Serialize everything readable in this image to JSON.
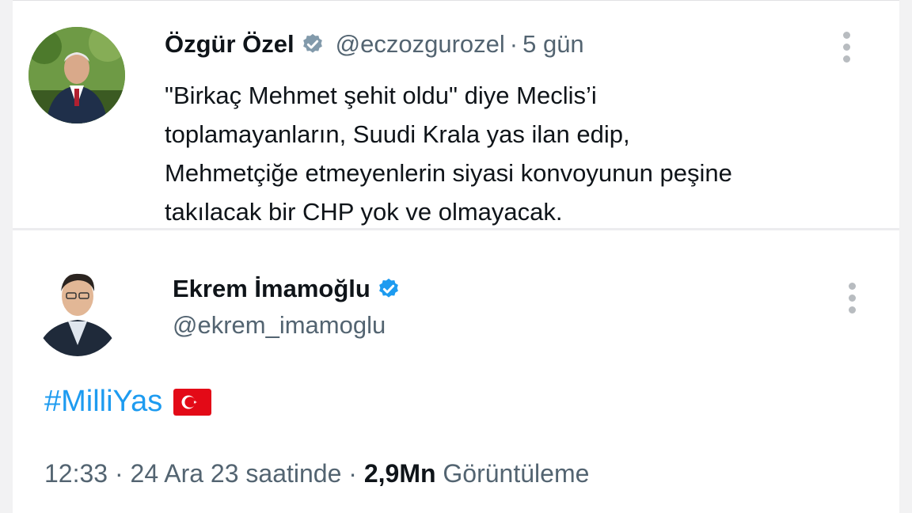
{
  "tweet1": {
    "author_name": "Özgür Özel",
    "handle": "@eczozgurozel",
    "separator": "·",
    "time": "5 gün",
    "text_lines": [
      "\"Birkaç Mehmet şehit oldu\" diye Meclis’i",
      "toplamayanların, Suudi Krala yas ilan edip,",
      "Mehmetçiğe etmeyenlerin siyasi konvoyunun peşine",
      "takılacak bir CHP yok ve olmayacak."
    ],
    "verified": true,
    "more_icon": "more-vertical-icon"
  },
  "tweet2": {
    "author_name": "Ekrem İmamoğlu",
    "handle": "@ekrem_imamoglu",
    "hashtag": "#MilliYas",
    "flag": "turkey-flag-icon",
    "meta_time": "12:33 · 24 Ara 23 saatinde ·",
    "views_count": "2,9Mn",
    "views_label": "Görüntüleme",
    "verified": true,
    "more_icon": "more-vertical-icon"
  },
  "colors": {
    "verified_blue": "#1d9bf0",
    "verified_gray": "#829aab",
    "hashtag": "#1d9bf0",
    "secondary_text": "#536471"
  }
}
